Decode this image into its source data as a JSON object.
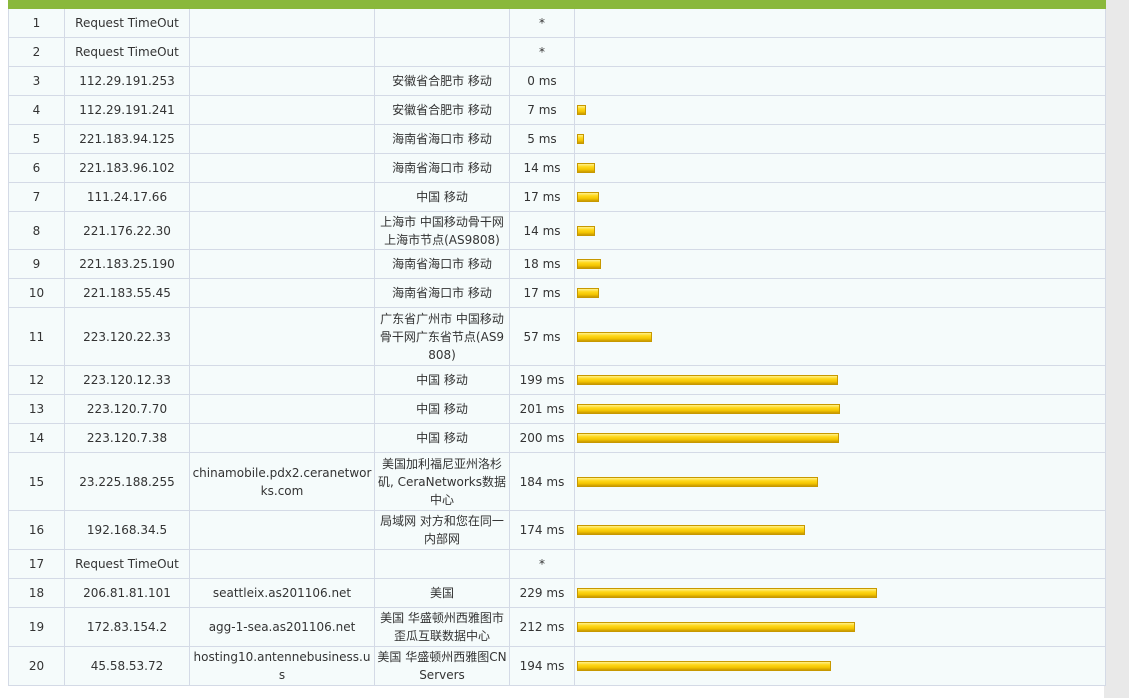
{
  "bar_scale_ms_max": 229,
  "hops": [
    {
      "hop": "1",
      "ip": "Request TimeOut",
      "host": "",
      "location": "",
      "time": "*",
      "ms": null
    },
    {
      "hop": "2",
      "ip": "Request TimeOut",
      "host": "",
      "location": "",
      "time": "*",
      "ms": null
    },
    {
      "hop": "3",
      "ip": "112.29.191.253",
      "host": "",
      "location": "安徽省合肥市 移动",
      "time": "0 ms",
      "ms": 0
    },
    {
      "hop": "4",
      "ip": "112.29.191.241",
      "host": "",
      "location": "安徽省合肥市 移动",
      "time": "7 ms",
      "ms": 7
    },
    {
      "hop": "5",
      "ip": "221.183.94.125",
      "host": "",
      "location": "海南省海口市 移动",
      "time": "5 ms",
      "ms": 5
    },
    {
      "hop": "6",
      "ip": "221.183.96.102",
      "host": "",
      "location": "海南省海口市 移动",
      "time": "14 ms",
      "ms": 14
    },
    {
      "hop": "7",
      "ip": "111.24.17.66",
      "host": "",
      "location": "中国 移动",
      "time": "17 ms",
      "ms": 17
    },
    {
      "hop": "8",
      "ip": "221.176.22.30",
      "host": "",
      "location": "上海市 中国移动骨干网上海市节点(AS9808)",
      "time": "14 ms",
      "ms": 14
    },
    {
      "hop": "9",
      "ip": "221.183.25.190",
      "host": "",
      "location": "海南省海口市 移动",
      "time": "18 ms",
      "ms": 18
    },
    {
      "hop": "10",
      "ip": "221.183.55.45",
      "host": "",
      "location": "海南省海口市 移动",
      "time": "17 ms",
      "ms": 17
    },
    {
      "hop": "11",
      "ip": "223.120.22.33",
      "host": "",
      "location": "广东省广州市 中国移动骨干网广东省节点(AS9808)",
      "time": "57 ms",
      "ms": 57
    },
    {
      "hop": "12",
      "ip": "223.120.12.33",
      "host": "",
      "location": "中国 移动",
      "time": "199 ms",
      "ms": 199
    },
    {
      "hop": "13",
      "ip": "223.120.7.70",
      "host": "",
      "location": "中国 移动",
      "time": "201 ms",
      "ms": 201
    },
    {
      "hop": "14",
      "ip": "223.120.7.38",
      "host": "",
      "location": "中国 移动",
      "time": "200 ms",
      "ms": 200
    },
    {
      "hop": "15",
      "ip": "23.225.188.255",
      "host": "chinamobile.pdx2.ceranetworks.com",
      "location": "美国加利福尼亚州洛杉矶, CeraNetworks数据中心",
      "time": "184 ms",
      "ms": 184
    },
    {
      "hop": "16",
      "ip": "192.168.34.5",
      "host": "",
      "location": "局域网 对方和您在同一内部网",
      "time": "174 ms",
      "ms": 174
    },
    {
      "hop": "17",
      "ip": "Request TimeOut",
      "host": "",
      "location": "",
      "time": "*",
      "ms": null
    },
    {
      "hop": "18",
      "ip": "206.81.81.101",
      "host": "seattleix.as201106.net",
      "location": "美国",
      "time": "229 ms",
      "ms": 229
    },
    {
      "hop": "19",
      "ip": "172.83.154.2",
      "host": "agg-1-sea.as201106.net",
      "location": "美国 华盛顿州西雅图市 歪瓜互联数据中心",
      "time": "212 ms",
      "ms": 212
    },
    {
      "hop": "20",
      "ip": "45.58.53.72",
      "host": "hosting10.antennebusiness.us",
      "location": "美国 华盛顿州西雅图CN Servers",
      "time": "194 ms",
      "ms": 194
    }
  ]
}
